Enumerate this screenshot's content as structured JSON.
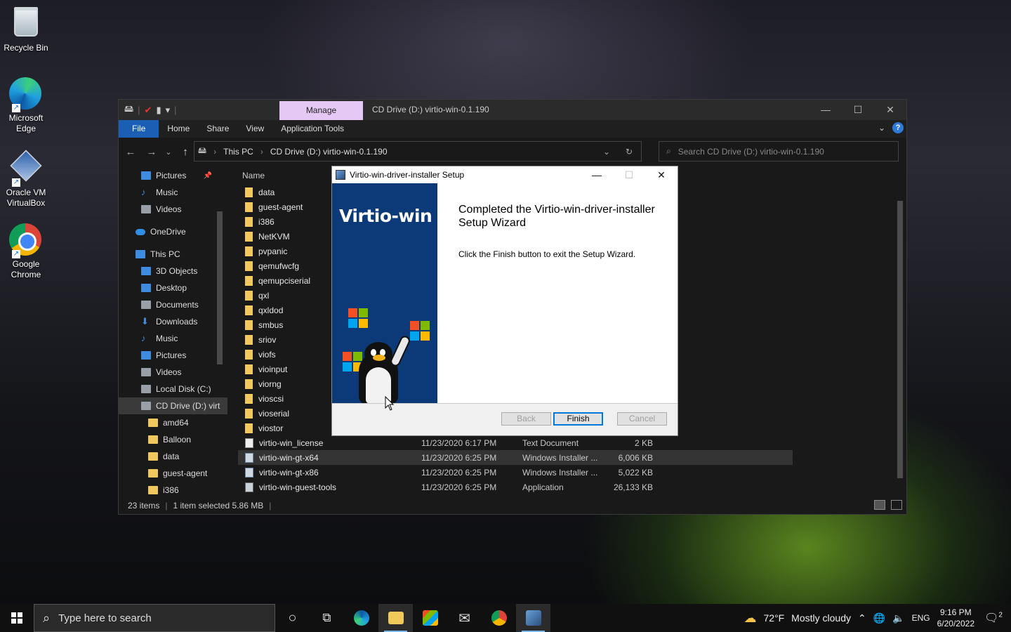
{
  "desktop": {
    "icons": [
      {
        "label": "Recycle Bin"
      },
      {
        "label": "Microsoft Edge"
      },
      {
        "label": "Oracle VM VirtualBox"
      },
      {
        "label": "Google Chrome"
      }
    ]
  },
  "explorer": {
    "manage_tab": "Manage",
    "title": "CD Drive (D:) virtio-win-0.1.190",
    "ribbon_tabs": [
      "File",
      "Home",
      "Share",
      "View",
      "Application Tools"
    ],
    "breadcrumb": [
      "This PC",
      "CD Drive (D:) virtio-win-0.1.190"
    ],
    "search_placeholder": "Search CD Drive (D:) virtio-win-0.1.190",
    "nav_items": [
      {
        "label": "Pictures",
        "icon": "pictures-icon"
      },
      {
        "label": "Music",
        "icon": "music-icon"
      },
      {
        "label": "Videos",
        "icon": "videos-icon"
      },
      {
        "label": "OneDrive",
        "icon": "onedrive-icon"
      },
      {
        "label": "This PC",
        "icon": "computer-icon"
      },
      {
        "label": "3D Objects",
        "icon": "3d-objects-icon"
      },
      {
        "label": "Desktop",
        "icon": "desktop-icon"
      },
      {
        "label": "Documents",
        "icon": "documents-icon"
      },
      {
        "label": "Downloads",
        "icon": "downloads-icon"
      },
      {
        "label": "Music",
        "icon": "music-icon"
      },
      {
        "label": "Pictures",
        "icon": "pictures-icon"
      },
      {
        "label": "Videos",
        "icon": "videos-icon"
      },
      {
        "label": "Local Disk (C:)",
        "icon": "disk-icon"
      },
      {
        "label": "CD Drive (D:) virt",
        "icon": "cd-drive-icon"
      },
      {
        "label": "amd64",
        "icon": "folder-icon"
      },
      {
        "label": "Balloon",
        "icon": "folder-icon"
      },
      {
        "label": "data",
        "icon": "folder-icon"
      },
      {
        "label": "guest-agent",
        "icon": "folder-icon"
      },
      {
        "label": "i386",
        "icon": "folder-icon"
      }
    ],
    "column_name": "Name",
    "folders": [
      "data",
      "guest-agent",
      "i386",
      "NetKVM",
      "pvpanic",
      "qemufwcfg",
      "qemupciserial",
      "qxl",
      "qxldod",
      "smbus",
      "sriov",
      "viofs",
      "vioinput",
      "viorng",
      "vioscsi",
      "vioserial",
      "viostor"
    ],
    "files": [
      {
        "name": "virtio-win_license",
        "date": "11/23/2020 6:17 PM",
        "type": "Text Document",
        "size": "2 KB",
        "icon": "text-document-icon"
      },
      {
        "name": "virtio-win-gt-x64",
        "date": "11/23/2020 6:25 PM",
        "type": "Windows Installer ...",
        "size": "6,006 KB",
        "icon": "installer-icon"
      },
      {
        "name": "virtio-win-gt-x86",
        "date": "11/23/2020 6:25 PM",
        "type": "Windows Installer ...",
        "size": "5,022 KB",
        "icon": "installer-icon"
      },
      {
        "name": "virtio-win-guest-tools",
        "date": "11/23/2020 6:25 PM",
        "type": "Application",
        "size": "26,133 KB",
        "icon": "application-icon"
      }
    ],
    "status": {
      "items": "23 items",
      "selected": "1 item selected 5.86 MB"
    }
  },
  "dialog": {
    "title": "Virtio-win-driver-installer Setup",
    "brand": "Virtio-win",
    "heading": "Completed the Virtio-win-driver-installer Setup Wizard",
    "text": "Click the Finish button to exit the Setup Wizard.",
    "back": "Back",
    "finish": "Finish",
    "cancel": "Cancel"
  },
  "taskbar": {
    "search_placeholder": "Type here to search",
    "weather": "72°F",
    "weather_desc": "Mostly cloudy",
    "language": "ENG",
    "time": "9:16 PM",
    "date": "6/20/2022",
    "notif_count": "2"
  },
  "colors": {
    "accent": "#1a5fb4",
    "manage_tab": "#e5c8f4",
    "banner": "#0c3a78"
  }
}
